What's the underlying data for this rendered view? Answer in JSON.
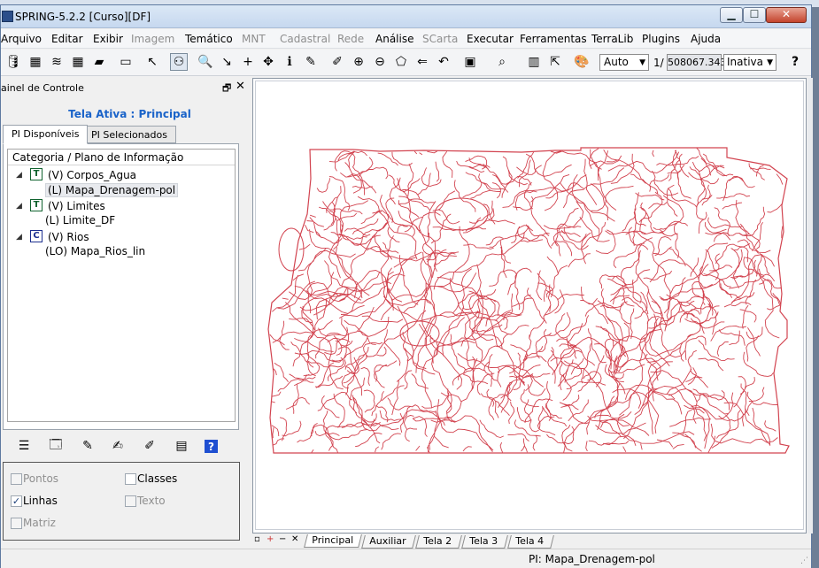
{
  "window": {
    "title": "SPRING-5.2.2 [Curso][DF]",
    "minimize_label": "▁",
    "maximize_label": "☐",
    "close_label": "✕"
  },
  "menu": [
    {
      "label": "Arquivo",
      "enabled": true
    },
    {
      "label": "Editar",
      "enabled": true
    },
    {
      "label": "Exibir",
      "enabled": true
    },
    {
      "label": "Imagem",
      "enabled": false
    },
    {
      "label": "Temático",
      "enabled": true
    },
    {
      "label": "MNT",
      "enabled": false
    },
    {
      "label": "Cadastral",
      "enabled": false
    },
    {
      "label": "Rede",
      "enabled": false
    },
    {
      "label": "Análise",
      "enabled": true
    },
    {
      "label": "SCarta",
      "enabled": false
    },
    {
      "label": "Executar",
      "enabled": true
    },
    {
      "label": "Ferramentas",
      "enabled": true
    },
    {
      "label": "TerraLib",
      "enabled": true
    },
    {
      "label": "Plugins",
      "enabled": true
    },
    {
      "label": "Ajuda",
      "enabled": true
    }
  ],
  "toolbar": {
    "icons": [
      "database-icon",
      "project-icon",
      "layers-icon",
      "grid-icon",
      "polygon-icon",
      "screen-icon",
      "cursor-icon",
      "pointer-tool-icon",
      "zoom-glass-icon",
      "arrow-select-icon",
      "crosshair-icon",
      "pan-icon",
      "info-icon",
      "edit-icon",
      "pencil-icon",
      "zoom-in-icon",
      "zoom-out-icon",
      "zoom-area-icon",
      "back-icon",
      "undo-icon",
      "paint-icon",
      "magnify-icon",
      "table-icon",
      "cursor-plus-icon",
      "palette-icon"
    ],
    "zoom_value": "Auto",
    "scale_prefix": "1/",
    "scale_value": "508067.343",
    "state_value": "Inativa",
    "help_label": "?"
  },
  "panel": {
    "title": "ainel de Controle",
    "pin_label": "🗗",
    "close_label": "✕",
    "active_screen": "Tela Ativa : Principal",
    "tabs": [
      "PI Disponíveis",
      "PI Selecionados"
    ],
    "tree_header": "Categoria / Plano de Informação",
    "categories": [
      {
        "toggle": "◢",
        "icon": "T",
        "label": "(V) Corpos_Agua",
        "child": "(L) Mapa_Drenagem-pol"
      },
      {
        "toggle": "◢",
        "icon": "T",
        "label": "(V) Limites",
        "child": "(L) Limite_DF"
      },
      {
        "toggle": "◢",
        "icon": "C",
        "label": "(V) Rios",
        "child": "(LO) Mapa_Rios_lin"
      }
    ],
    "tools": [
      "list-icon",
      "view-icon",
      "wand-icon",
      "brush-icon",
      "pen-icon",
      "legend-icon",
      "help-icon"
    ],
    "options": [
      {
        "label": "Pontos",
        "checked": false,
        "enabled": false
      },
      {
        "label": "Classes",
        "checked": false,
        "enabled": true
      },
      {
        "label": "Linhas",
        "checked": true,
        "enabled": true
      },
      {
        "label": "Texto",
        "checked": false,
        "enabled": false
      },
      {
        "label": "Matriz",
        "checked": false,
        "enabled": false
      }
    ]
  },
  "map": {
    "line_color": "#d2434f"
  },
  "screens": {
    "tabs": [
      "Principal",
      "Auxiliar",
      "Tela 2",
      "Tela 3",
      "Tela 4"
    ],
    "active": "Principal"
  },
  "status": {
    "text": "PI: Mapa_Drenagem-pol"
  }
}
